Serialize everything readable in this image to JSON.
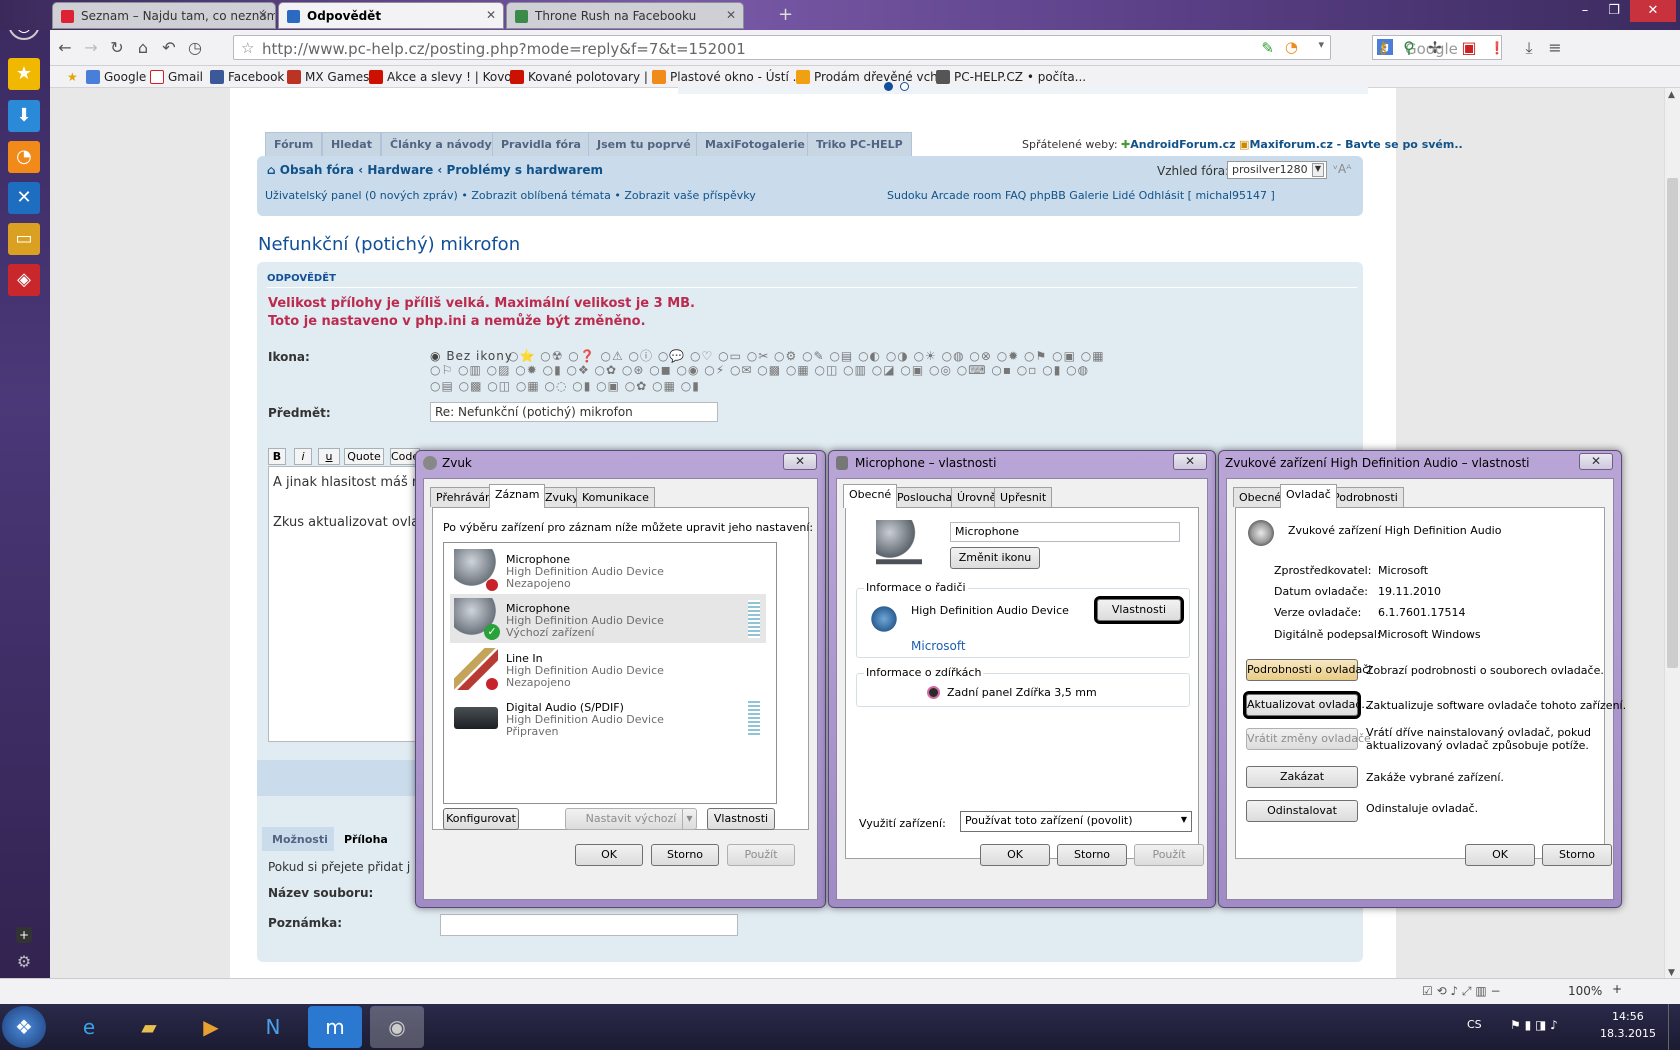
{
  "browser": {
    "tabs": [
      {
        "title": "Seznam – Najdu tam, co neznám",
        "fav_color": "#d23"
      },
      {
        "title": "Odpovědět",
        "fav_color": "#2a6ac0"
      },
      {
        "title": "Throne Rush na Facebooku",
        "fav_color": "#3b8a4a"
      }
    ],
    "url": "http://www.pc-help.cz/posting.php?mode=reply&f=7&t=152001",
    "search_placeholder": "Google",
    "bookmarks": [
      "Google",
      "Gmail",
      "Facebook",
      "MX Games",
      "Akce a slevy ! | Kovo...",
      "Kované polotovary | ...",
      "Plastové okno - Ústí ...",
      "Prodám dřevěné vch...",
      "PC-HELP.CZ • počíta..."
    ],
    "zoom": "100%"
  },
  "forum": {
    "tabs": [
      "Fórum",
      "Hledat",
      "Články a návody",
      "Pravidla fóra",
      "Jsem tu poprvé",
      "MaxiFotogalerie",
      "Triko PC-HELP"
    ],
    "friends_label": "Spřátelené weby:",
    "friend1": "AndroidForum.cz",
    "friend2": "Maxiforum.cz - Bavte se po svém..",
    "crumb1": "Obsah fóra",
    "crumb2": "Hardware",
    "crumb3": "Problémy s hardwarem",
    "style_label": "Vzhled fóra:",
    "style_value": "prosilver1280",
    "userbar_left": "Uživatelský panel (0 nových zpráv) • Zobrazit oblíbená témata • Zobrazit vaše příspěvky",
    "userbar_right": "Sudoku   Arcade room   FAQ phpBB   Galerie   Lidé   Odhlásit [ michal95147 ]",
    "post_title": "Nefunkční (potichý) mikrofon",
    "section": "ODPOVĚDĚT",
    "error1": "Velikost přílohy je příliš velká. Maximální velikost je 3 MB.",
    "error2": "Toto je nastaveno v php.ini a nemůže být změněno.",
    "icon_label": "Ikona:",
    "no_icon": "Bez ikony",
    "subject_label": "Předmět:",
    "subject_value": "Re: Nefunkční (potichý) mikrofon",
    "bb_buttons": [
      "B",
      "i",
      "u",
      "Quote",
      "Code"
    ],
    "text_line1": "A jinak hlasitost máš nas",
    "text_line2": "Zkus aktualizovat ovladač",
    "lower_tabs": [
      "Možnosti",
      "Příloha"
    ],
    "attach_text": "Pokud si přejete přidat j",
    "file_label": "Název souboru:",
    "note_label": "Poznámka:"
  },
  "zvuk": {
    "title": "Zvuk",
    "tabs": [
      "Přehrávání",
      "Záznam",
      "Zvuky",
      "Komunikace"
    ],
    "intro": "Po výběru zařízení pro záznam níže můžete upravit jeho nastavení:",
    "devices": [
      {
        "name": "Microphone",
        "driver": "High Definition Audio Device",
        "status": "Nezapojeno"
      },
      {
        "name": "Microphone",
        "driver": "High Definition Audio Device",
        "status": "Výchozí zařízení"
      },
      {
        "name": "Line In",
        "driver": "High Definition Audio Device",
        "status": "Nezapojeno"
      },
      {
        "name": "Digital Audio (S/PDIF)",
        "driver": "High Definition Audio Device",
        "status": "Připraven"
      }
    ],
    "configure": "Konfigurovat",
    "set_default": "Nastavit výchozí",
    "properties": "Vlastnosti",
    "ok": "OK",
    "cancel": "Storno",
    "apply": "Použít"
  },
  "mic": {
    "title": "Microphone – vlastnosti",
    "tabs": [
      "Obecné",
      "Poslouchat",
      "Úrovně",
      "Upřesnit"
    ],
    "name_value": "Microphone",
    "change_icon": "Změnit ikonu",
    "controller_group": "Informace o řadiči",
    "controller_name": "High Definition Audio Device",
    "controller_props": "Vlastnosti",
    "vendor": "Microsoft",
    "jack_group": "Informace o zdířkách",
    "jack": "Zadní panel Zdířka 3,5 mm",
    "usage_label": "Využití zařízení:",
    "usage_value": "Používat toto zařízení (povolit)",
    "ok": "OK",
    "cancel": "Storno",
    "apply": "Použít"
  },
  "hda": {
    "title": "Zvukové zařízení High Definition Audio – vlastnosti",
    "tabs": [
      "Obecné",
      "Ovladač",
      "Podrobnosti"
    ],
    "device": "Zvukové zařízení High Definition Audio",
    "rows": [
      {
        "k": "Zprostředkovatel:",
        "v": "Microsoft"
      },
      {
        "k": "Datum ovladače:",
        "v": "19.11.2010"
      },
      {
        "k": "Verze ovladače:",
        "v": "6.1.7601.17514"
      },
      {
        "k": "Digitálně podepsal:",
        "v": "Microsoft Windows"
      }
    ],
    "btn_details": "Podrobnosti o ovladači",
    "desc_details": "Zobrazí podrobnosti o souborech ovladače.",
    "btn_update": "Aktualizovat ovladač...",
    "desc_update": "Zaktualizuje software ovladače tohoto zařízení.",
    "btn_rollback": "Vrátit změny ovladače",
    "desc_rollback1": "Vrátí dříve nainstalovaný ovladač, pokud",
    "desc_rollback2": "aktualizovaný ovladač způsobuje potíže.",
    "btn_disable": "Zakázat",
    "desc_disable": "Zakáže vybrané zařízení.",
    "btn_uninstall": "Odinstalovat",
    "desc_uninstall": "Odinstaluje ovladač.",
    "ok": "OK",
    "cancel": "Storno"
  },
  "taskbar": {
    "lang": "CS",
    "time": "14:56",
    "date": "18.3.2015"
  }
}
